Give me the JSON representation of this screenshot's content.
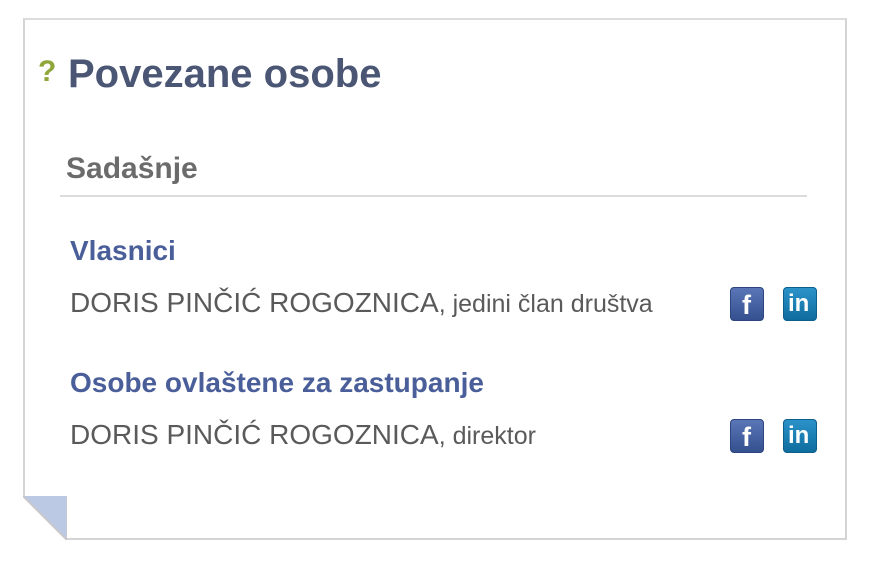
{
  "panel": {
    "help_icon": "?",
    "title": "Povezane osobe",
    "subtitle": "Sadašnje"
  },
  "sections": [
    {
      "heading": "Vlasnici",
      "person_name": "DORIS PINČIĆ ROGOZNICA",
      "person_role": ", jedini član društva",
      "icons": [
        "facebook-icon",
        "linkedin-icon"
      ]
    },
    {
      "heading": "Osobe ovlaštene za zastupanje",
      "person_name": "DORIS PINČIĆ ROGOZNICA",
      "person_role": ", direktor",
      "icons": [
        "facebook-icon",
        "linkedin-icon"
      ]
    }
  ],
  "colors": {
    "title": "#4b5675",
    "section_heading": "#4a5f9a",
    "help_icon": "#8fa63a",
    "facebook": "#3b5998",
    "linkedin": "#0e76a8"
  }
}
